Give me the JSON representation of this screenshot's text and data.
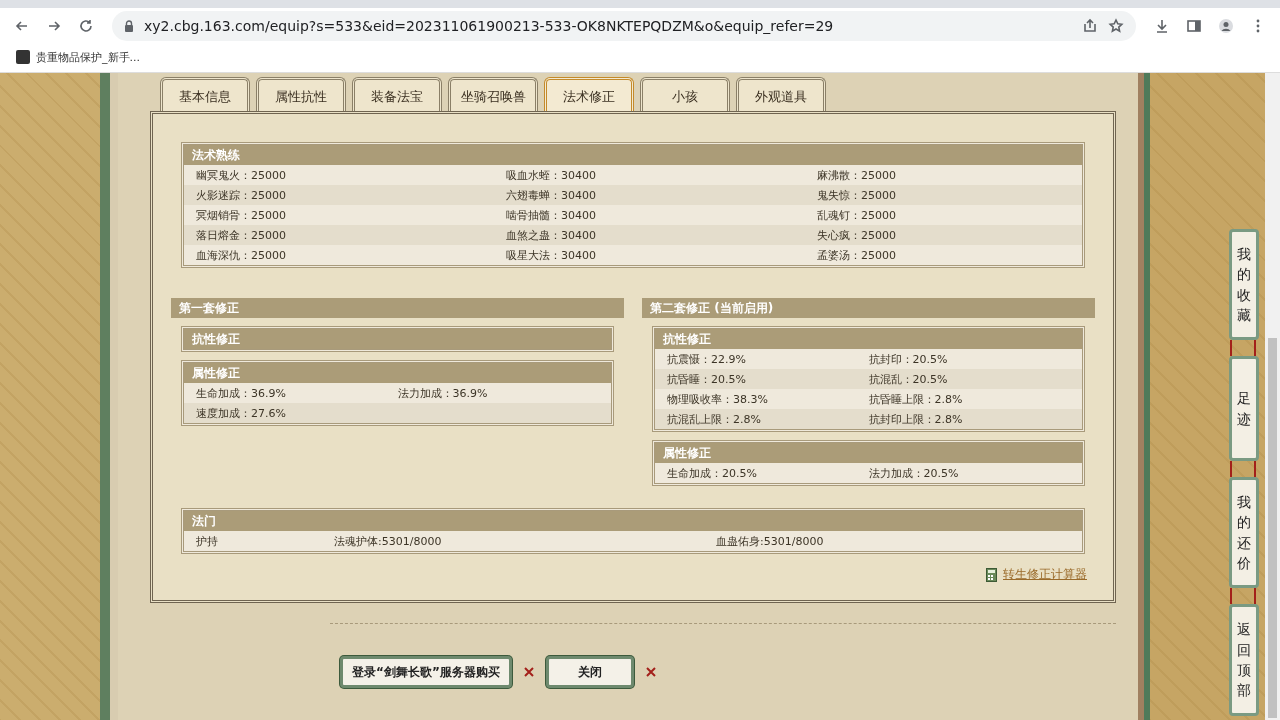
{
  "browser": {
    "url": "xy2.cbg.163.com/equip?s=533&eid=202311061900213-533-OK8NKTEPQDZM&o&equip_refer=29",
    "bookmarks": [
      "贵重物品保护_新手..."
    ]
  },
  "tabs": [
    {
      "label": "基本信息",
      "selected": false
    },
    {
      "label": "属性抗性",
      "selected": false
    },
    {
      "label": "装备法宝",
      "selected": false
    },
    {
      "label": "坐骑召唤兽",
      "selected": false
    },
    {
      "label": "法术修正",
      "selected": true
    },
    {
      "label": "小孩",
      "selected": false
    },
    {
      "label": "外观道具",
      "selected": false
    }
  ],
  "skills": {
    "title": "法术熟练",
    "rows": [
      [
        "幽冥鬼火：25000",
        "吸血水蛭：30400",
        "麻沸散：25000"
      ],
      [
        "火影迷踪：25000",
        "六翅毒蝉：30400",
        "鬼失惊：25000"
      ],
      [
        "冥烟销骨：25000",
        "啮骨抽髓：30400",
        "乱魂钉：25000"
      ],
      [
        "落日熔金：25000",
        "血煞之蛊：30400",
        "失心疯：25000"
      ],
      [
        "血海深仇：25000",
        "吸星大法：30400",
        "孟婆汤：25000"
      ]
    ]
  },
  "sets": [
    {
      "title": "第一套修正",
      "groups": [
        {
          "title": "抗性修正"
        },
        {
          "title": "属性修正",
          "rows": [
            [
              "生命加成：36.9%",
              "法力加成：36.9%"
            ],
            [
              "速度加成：27.6%"
            ]
          ]
        }
      ]
    },
    {
      "title": "第二套修正 (当前启用)",
      "groups": [
        {
          "title": "抗性修正",
          "rows": [
            [
              "抗震慑：22.9%",
              "抗封印：20.5%"
            ],
            [
              "抗昏睡：20.5%",
              "抗混乱：20.5%"
            ],
            [
              "物理吸收率：38.3%",
              "抗昏睡上限：2.8%"
            ],
            [
              "抗混乱上限：2.8%",
              "抗封印上限：2.8%"
            ]
          ]
        },
        {
          "title": "属性修正",
          "rows": [
            [
              "生命加成：20.5%",
              "法力加成：20.5%"
            ]
          ]
        }
      ]
    }
  ],
  "school": {
    "title": "法门",
    "cells": [
      "护持",
      "法魂护体:5301/8000",
      "血蛊佑身:5301/8000"
    ]
  },
  "calculator_link": "转生修正计算器",
  "buttons": [
    "登录“剑舞长歌”服务器购买",
    "关闭"
  ],
  "side_buttons": [
    "我的收藏",
    "足迹",
    "我的还价",
    "返回顶部"
  ]
}
